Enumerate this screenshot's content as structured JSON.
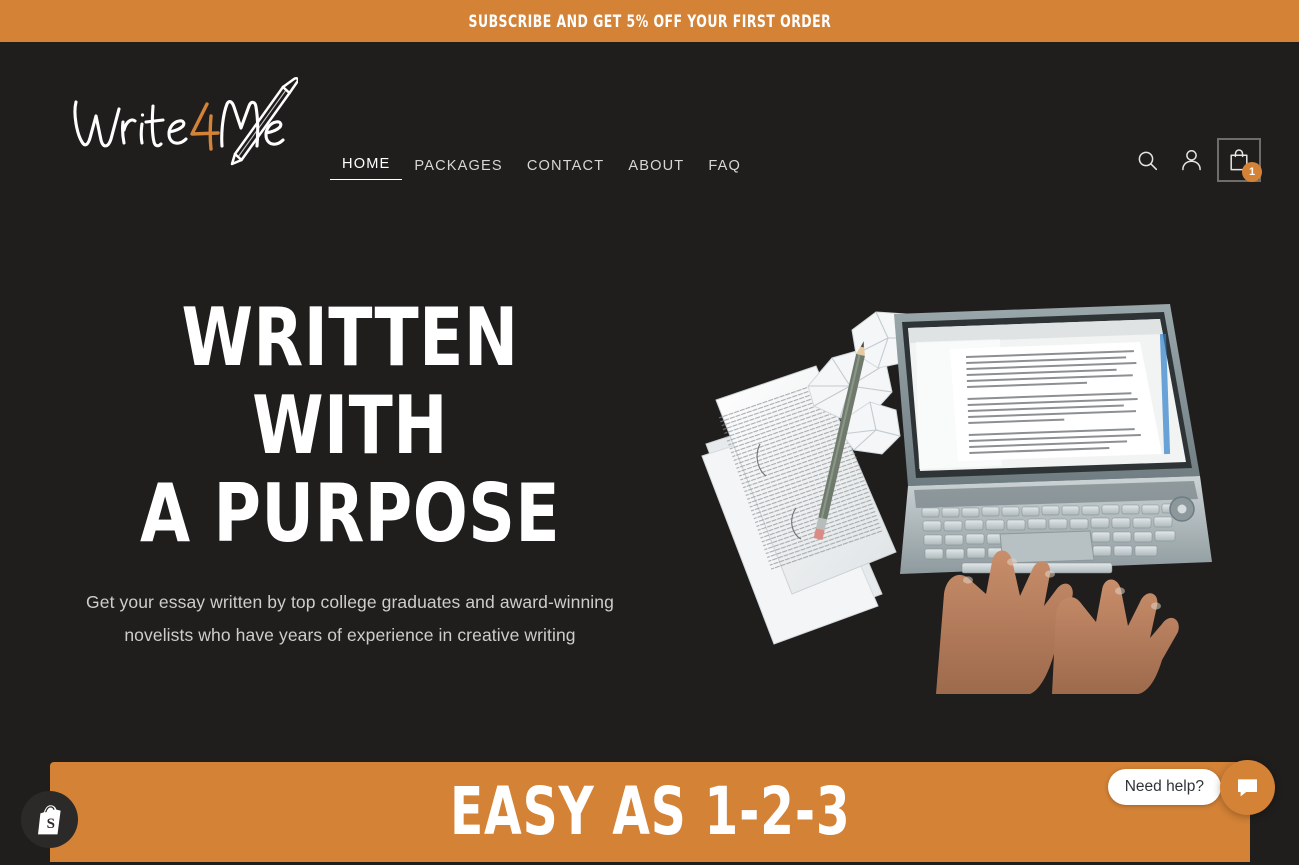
{
  "announcement": {
    "text": "SUBSCRIBE AND GET 5% OFF YOUR FIRST ORDER",
    "background_color": "#d38236",
    "text_color": "#ffffff"
  },
  "brand": {
    "name": "Write4Me",
    "word_part_1": "Write",
    "accent_char": "4",
    "word_part_2": "Me",
    "accent_color": "#d38236",
    "logo_icon": "pencil-icon"
  },
  "nav": {
    "items": [
      {
        "label": "HOME",
        "active": true
      },
      {
        "label": "PACKAGES",
        "active": false
      },
      {
        "label": "CONTACT",
        "active": false
      },
      {
        "label": "ABOUT",
        "active": false
      },
      {
        "label": "FAQ",
        "active": false
      }
    ]
  },
  "header_actions": {
    "search_icon": "search-icon",
    "account_icon": "user-icon",
    "cart_icon": "shopping-bag-icon",
    "cart_count": "1",
    "cart_badge_color": "#d38236"
  },
  "hero": {
    "title_line_1": "WRITTEN WITH",
    "title_line_2": "A PURPOSE",
    "subtitle": "Get your essay written by top college graduates and award-winning novelists who have years of experience in creative writing",
    "image_alt": "hands typing on a laptop surrounded by printed manuscript pages, a pencil and crumpled paper"
  },
  "band": {
    "text": "EASY AS 1-2-3",
    "background_color": "#d38236"
  },
  "shopify_badge": {
    "icon": "shopify-bag-icon"
  },
  "chat": {
    "prompt": "Need help?",
    "icon": "chat-bubble-icon",
    "button_color": "#d38236"
  },
  "theme": {
    "background_color": "#1f1e1d",
    "accent_color": "#d38236",
    "text_color": "#ffffff",
    "muted_text_color": "#cfcdca"
  }
}
